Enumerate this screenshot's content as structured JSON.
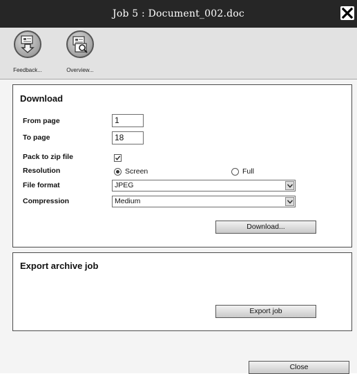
{
  "window": {
    "title": "Job 5 : Document_002.doc"
  },
  "toolbar": {
    "items": [
      {
        "label": "Feedback...",
        "icon": "feedback-icon"
      },
      {
        "label": "Overview...",
        "icon": "overview-icon"
      }
    ]
  },
  "download": {
    "heading": "Download",
    "from_page": {
      "label": "From page",
      "value": "1"
    },
    "to_page": {
      "label": "To page",
      "value": "18"
    },
    "pack_zip": {
      "label": "Pack to zip file",
      "checked": true
    },
    "resolution": {
      "label": "Resolution",
      "options": [
        "Screen",
        "Full"
      ],
      "selected": "Screen"
    },
    "file_format": {
      "label": "File format",
      "value": "JPEG"
    },
    "compression": {
      "label": "Compression",
      "value": "Medium"
    },
    "button_label": "Download..."
  },
  "export": {
    "heading": "Export archive job",
    "button_label": "Export job"
  },
  "footer": {
    "close_label": "Close"
  },
  "colors": {
    "titlebar": "#262626",
    "toolbar": "#e2e2e2",
    "main_bg": "#f4f4f4",
    "panel_border": "#4a4a4a"
  }
}
